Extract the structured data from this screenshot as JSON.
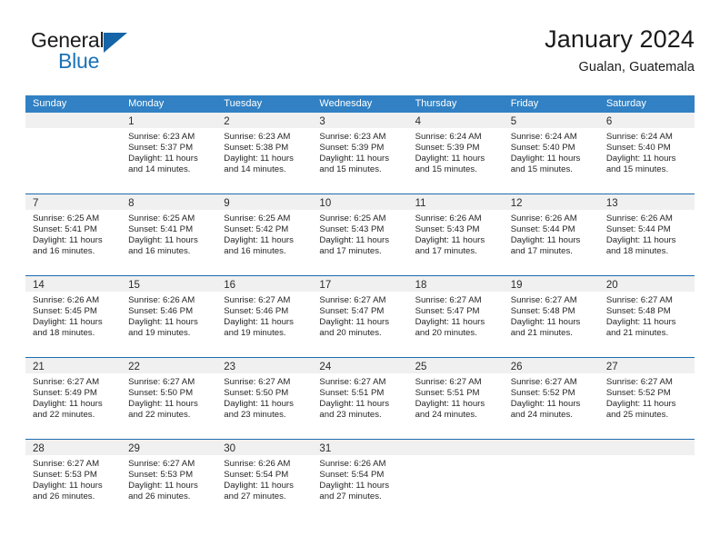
{
  "brand": {
    "name_part1": "General",
    "name_part2": "Blue",
    "logo_icon": "blue-triangle-icon",
    "accent_color": "#1a73b8"
  },
  "header": {
    "title": "January 2024",
    "subtitle": "Gualan, Guatemala"
  },
  "calendar": {
    "header_bg_color": "#3181c4",
    "row_divider_color": "#1d6cb0",
    "daynum_band_color": "#f0f0f0",
    "weekdays": [
      "Sunday",
      "Monday",
      "Tuesday",
      "Wednesday",
      "Thursday",
      "Friday",
      "Saturday"
    ],
    "weeks": [
      [
        {
          "day": "",
          "lines": []
        },
        {
          "day": "1",
          "lines": [
            "Sunrise: 6:23 AM",
            "Sunset: 5:37 PM",
            "Daylight: 11 hours",
            "and 14 minutes."
          ]
        },
        {
          "day": "2",
          "lines": [
            "Sunrise: 6:23 AM",
            "Sunset: 5:38 PM",
            "Daylight: 11 hours",
            "and 14 minutes."
          ]
        },
        {
          "day": "3",
          "lines": [
            "Sunrise: 6:23 AM",
            "Sunset: 5:39 PM",
            "Daylight: 11 hours",
            "and 15 minutes."
          ]
        },
        {
          "day": "4",
          "lines": [
            "Sunrise: 6:24 AM",
            "Sunset: 5:39 PM",
            "Daylight: 11 hours",
            "and 15 minutes."
          ]
        },
        {
          "day": "5",
          "lines": [
            "Sunrise: 6:24 AM",
            "Sunset: 5:40 PM",
            "Daylight: 11 hours",
            "and 15 minutes."
          ]
        },
        {
          "day": "6",
          "lines": [
            "Sunrise: 6:24 AM",
            "Sunset: 5:40 PM",
            "Daylight: 11 hours",
            "and 15 minutes."
          ]
        }
      ],
      [
        {
          "day": "7",
          "lines": [
            "Sunrise: 6:25 AM",
            "Sunset: 5:41 PM",
            "Daylight: 11 hours",
            "and 16 minutes."
          ]
        },
        {
          "day": "8",
          "lines": [
            "Sunrise: 6:25 AM",
            "Sunset: 5:41 PM",
            "Daylight: 11 hours",
            "and 16 minutes."
          ]
        },
        {
          "day": "9",
          "lines": [
            "Sunrise: 6:25 AM",
            "Sunset: 5:42 PM",
            "Daylight: 11 hours",
            "and 16 minutes."
          ]
        },
        {
          "day": "10",
          "lines": [
            "Sunrise: 6:25 AM",
            "Sunset: 5:43 PM",
            "Daylight: 11 hours",
            "and 17 minutes."
          ]
        },
        {
          "day": "11",
          "lines": [
            "Sunrise: 6:26 AM",
            "Sunset: 5:43 PM",
            "Daylight: 11 hours",
            "and 17 minutes."
          ]
        },
        {
          "day": "12",
          "lines": [
            "Sunrise: 6:26 AM",
            "Sunset: 5:44 PM",
            "Daylight: 11 hours",
            "and 17 minutes."
          ]
        },
        {
          "day": "13",
          "lines": [
            "Sunrise: 6:26 AM",
            "Sunset: 5:44 PM",
            "Daylight: 11 hours",
            "and 18 minutes."
          ]
        }
      ],
      [
        {
          "day": "14",
          "lines": [
            "Sunrise: 6:26 AM",
            "Sunset: 5:45 PM",
            "Daylight: 11 hours",
            "and 18 minutes."
          ]
        },
        {
          "day": "15",
          "lines": [
            "Sunrise: 6:26 AM",
            "Sunset: 5:46 PM",
            "Daylight: 11 hours",
            "and 19 minutes."
          ]
        },
        {
          "day": "16",
          "lines": [
            "Sunrise: 6:27 AM",
            "Sunset: 5:46 PM",
            "Daylight: 11 hours",
            "and 19 minutes."
          ]
        },
        {
          "day": "17",
          "lines": [
            "Sunrise: 6:27 AM",
            "Sunset: 5:47 PM",
            "Daylight: 11 hours",
            "and 20 minutes."
          ]
        },
        {
          "day": "18",
          "lines": [
            "Sunrise: 6:27 AM",
            "Sunset: 5:47 PM",
            "Daylight: 11 hours",
            "and 20 minutes."
          ]
        },
        {
          "day": "19",
          "lines": [
            "Sunrise: 6:27 AM",
            "Sunset: 5:48 PM",
            "Daylight: 11 hours",
            "and 21 minutes."
          ]
        },
        {
          "day": "20",
          "lines": [
            "Sunrise: 6:27 AM",
            "Sunset: 5:48 PM",
            "Daylight: 11 hours",
            "and 21 minutes."
          ]
        }
      ],
      [
        {
          "day": "21",
          "lines": [
            "Sunrise: 6:27 AM",
            "Sunset: 5:49 PM",
            "Daylight: 11 hours",
            "and 22 minutes."
          ]
        },
        {
          "day": "22",
          "lines": [
            "Sunrise: 6:27 AM",
            "Sunset: 5:50 PM",
            "Daylight: 11 hours",
            "and 22 minutes."
          ]
        },
        {
          "day": "23",
          "lines": [
            "Sunrise: 6:27 AM",
            "Sunset: 5:50 PM",
            "Daylight: 11 hours",
            "and 23 minutes."
          ]
        },
        {
          "day": "24",
          "lines": [
            "Sunrise: 6:27 AM",
            "Sunset: 5:51 PM",
            "Daylight: 11 hours",
            "and 23 minutes."
          ]
        },
        {
          "day": "25",
          "lines": [
            "Sunrise: 6:27 AM",
            "Sunset: 5:51 PM",
            "Daylight: 11 hours",
            "and 24 minutes."
          ]
        },
        {
          "day": "26",
          "lines": [
            "Sunrise: 6:27 AM",
            "Sunset: 5:52 PM",
            "Daylight: 11 hours",
            "and 24 minutes."
          ]
        },
        {
          "day": "27",
          "lines": [
            "Sunrise: 6:27 AM",
            "Sunset: 5:52 PM",
            "Daylight: 11 hours",
            "and 25 minutes."
          ]
        }
      ],
      [
        {
          "day": "28",
          "lines": [
            "Sunrise: 6:27 AM",
            "Sunset: 5:53 PM",
            "Daylight: 11 hours",
            "and 26 minutes."
          ]
        },
        {
          "day": "29",
          "lines": [
            "Sunrise: 6:27 AM",
            "Sunset: 5:53 PM",
            "Daylight: 11 hours",
            "and 26 minutes."
          ]
        },
        {
          "day": "30",
          "lines": [
            "Sunrise: 6:26 AM",
            "Sunset: 5:54 PM",
            "Daylight: 11 hours",
            "and 27 minutes."
          ]
        },
        {
          "day": "31",
          "lines": [
            "Sunrise: 6:26 AM",
            "Sunset: 5:54 PM",
            "Daylight: 11 hours",
            "and 27 minutes."
          ]
        },
        {
          "day": "",
          "lines": []
        },
        {
          "day": "",
          "lines": []
        },
        {
          "day": "",
          "lines": []
        }
      ]
    ]
  }
}
